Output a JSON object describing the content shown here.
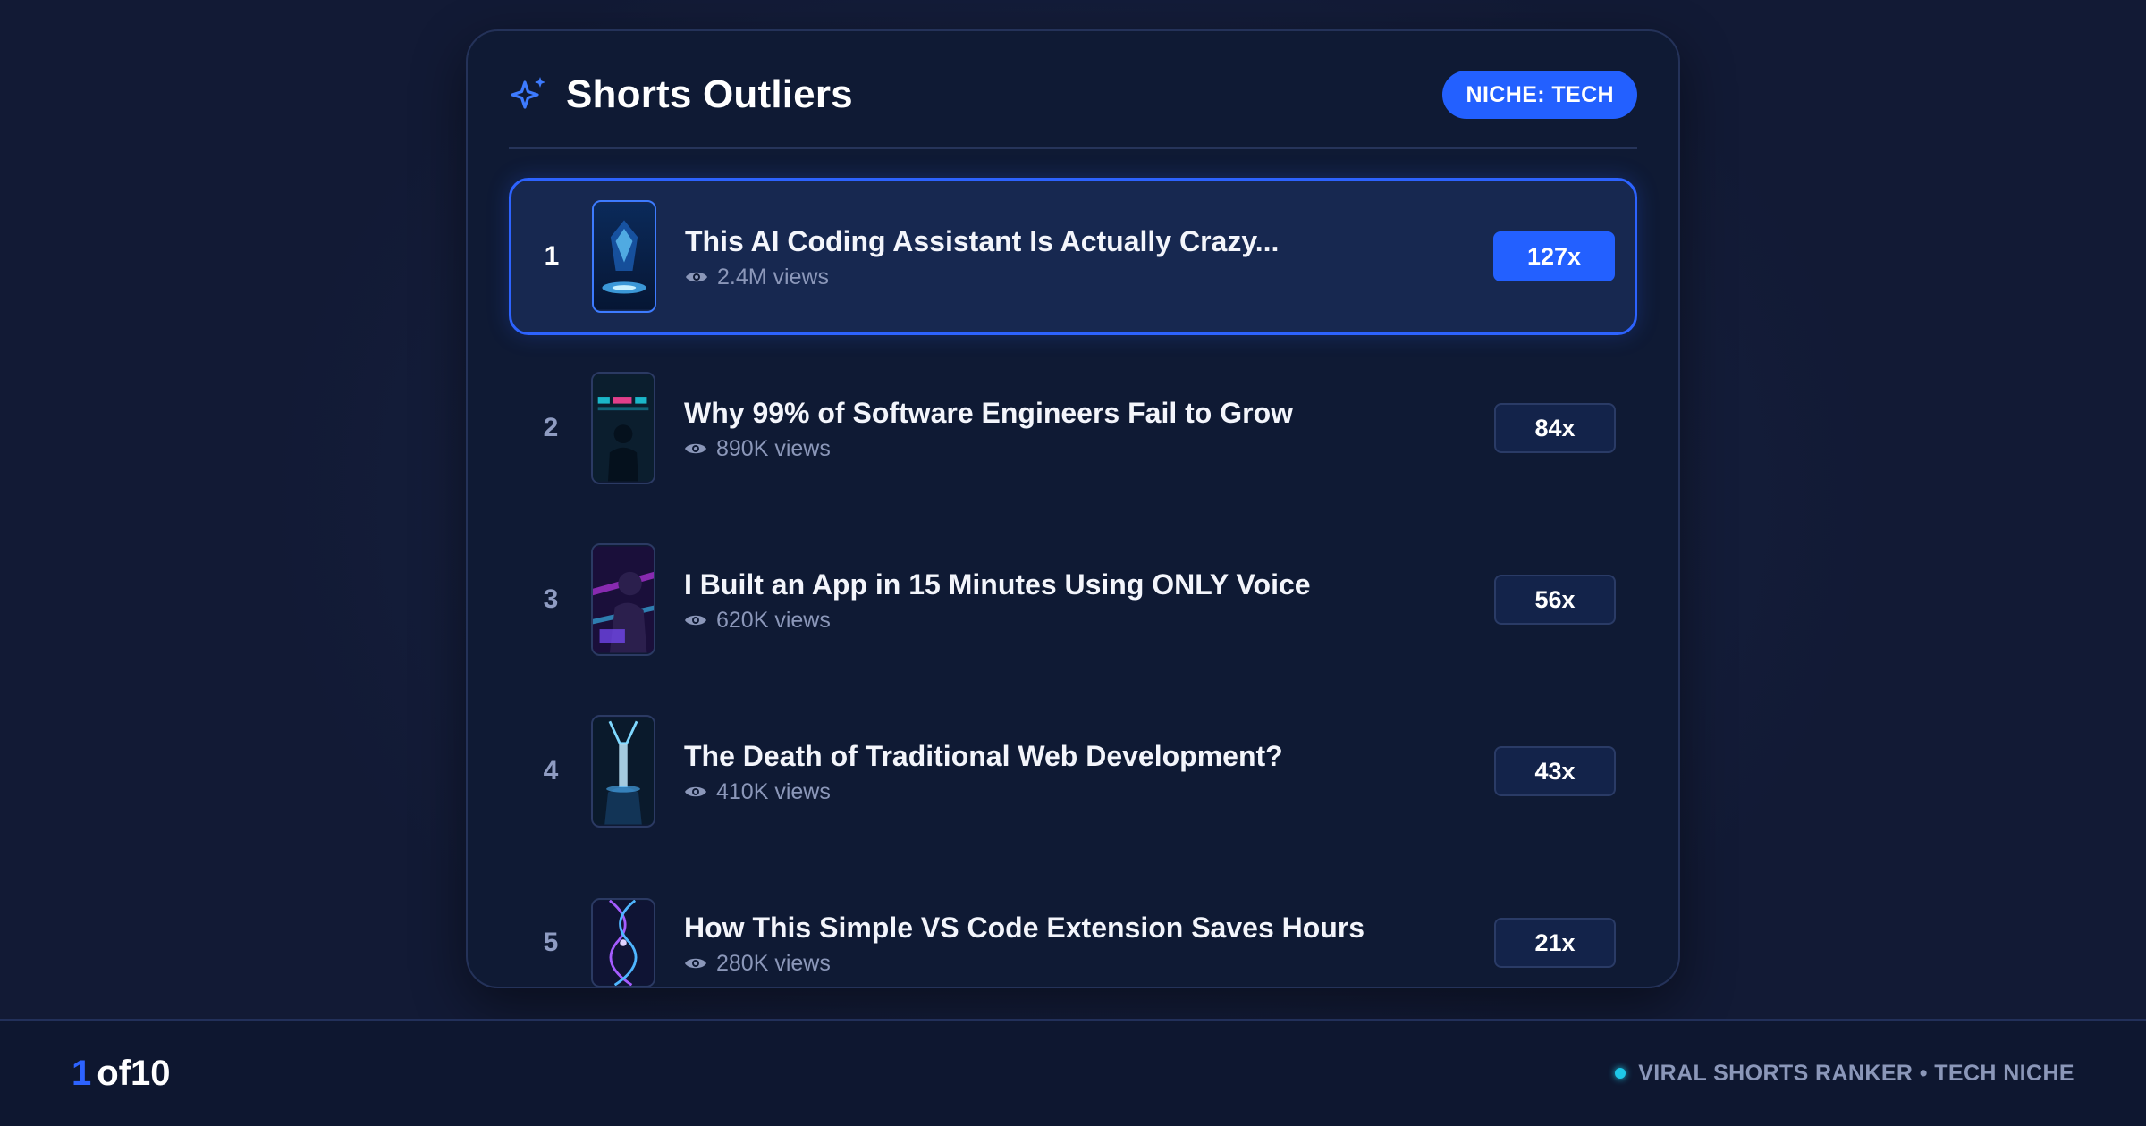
{
  "header": {
    "title": "Shorts Outliers",
    "icon": "sparkle-icon",
    "niche_badge": "NICHE: TECH"
  },
  "videos": [
    {
      "rank": "1",
      "title": "This AI Coding Assistant Is Actually Crazy...",
      "views": "2.4M views",
      "multiplier": "127x",
      "active": true
    },
    {
      "rank": "2",
      "title": "Why 99% of Software Engineers Fail to Grow",
      "views": "890K views",
      "multiplier": "84x",
      "active": false
    },
    {
      "rank": "3",
      "title": "I Built an App in 15 Minutes Using ONLY Voice",
      "views": "620K views",
      "multiplier": "56x",
      "active": false
    },
    {
      "rank": "4",
      "title": "The Death of Traditional Web Development?",
      "views": "410K views",
      "multiplier": "43x",
      "active": false
    },
    {
      "rank": "5",
      "title": "How This Simple VS Code Extension Saves Hours",
      "views": "280K views",
      "multiplier": "21x",
      "active": false
    }
  ],
  "footer": {
    "page_current": "1",
    "page_of": "of10",
    "brand_text": "VIRAL SHORTS RANKER • TECH NICHE"
  },
  "colors": {
    "accent": "#2360ff",
    "background": "#141d3a",
    "card": "#0f1a34",
    "status_dot": "#1ec8e8"
  }
}
